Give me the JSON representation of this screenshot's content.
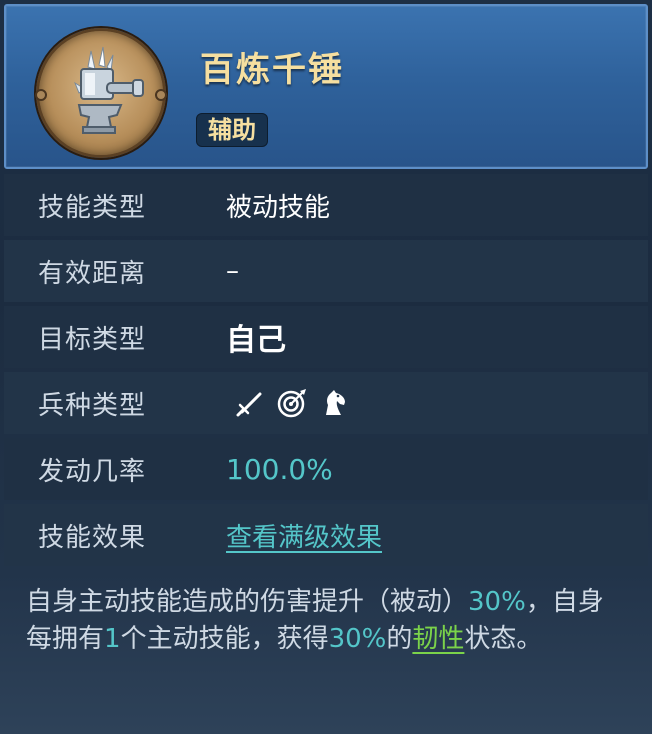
{
  "skill": {
    "name": "百炼千锤",
    "tag": "辅助",
    "icon": "hammer-icon"
  },
  "rows": [
    {
      "label": "技能类型",
      "value": "被动技能"
    },
    {
      "label": "有效距离",
      "value": "–"
    },
    {
      "label": "目标类型",
      "value": "自己"
    },
    {
      "label": "兵种类型",
      "icons": [
        "sword-icon",
        "bow-target-icon",
        "horse-icon"
      ]
    },
    {
      "label": "发动几率",
      "value": "100.0%"
    },
    {
      "label": "技能效果",
      "value": "查看满级效果"
    }
  ],
  "description": {
    "part1": "自身主动技能造成的伤害提升（被动）",
    "val1": "30%",
    "part2": "，自身每拥有",
    "val2": "1",
    "part3": "个主动技能，获得",
    "val3": "30%",
    "part4": "的",
    "keyword": "韧性",
    "part5": "状态。"
  },
  "colors": {
    "accent_teal": "#54c6c9",
    "title_gold": "#f6dfa0",
    "keyword_green": "#7bd34a",
    "header_blue": "#2f629c"
  }
}
